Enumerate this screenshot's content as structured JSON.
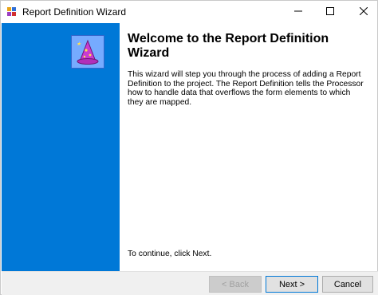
{
  "window": {
    "title": "Report Definition Wizard",
    "icon": "wizard-app-icon"
  },
  "caption_buttons": {
    "minimize_icon": "minimize-icon",
    "maximize_icon": "maximize-icon",
    "close_icon": "close-icon"
  },
  "side_panel": {
    "image": "wizard-hat-icon",
    "color": "#0078d7"
  },
  "content": {
    "title": "Welcome to the Report Definition Wizard",
    "body": "This wizard will step you through the process of adding a Report Definition to the project.  The Report Definition tells the Processor how to handle data that overflows the form elements to which they are mapped.",
    "continue": "To continue, click Next."
  },
  "buttons": {
    "back": "< Back",
    "next": "Next >",
    "cancel": "Cancel"
  }
}
